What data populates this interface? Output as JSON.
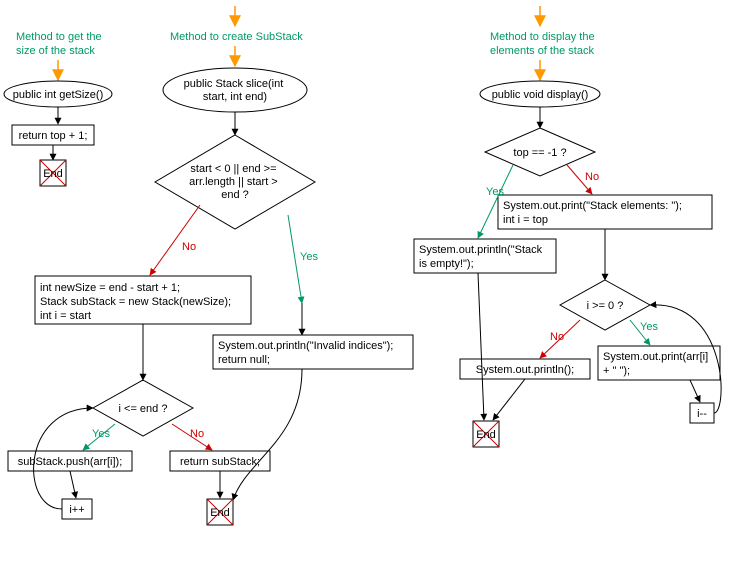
{
  "labels": {
    "yes": "Yes",
    "no": "No",
    "end": "End"
  },
  "colors": {
    "title": "#009966",
    "yes": "#009966",
    "no": "#cc0000",
    "arrowTitle": "#ff9900",
    "border": "#000000"
  },
  "left": {
    "title1": "Method to get the",
    "title2": "size of the stack",
    "sig": "public int getSize()",
    "ret": "return top + 1;"
  },
  "mid": {
    "title": "Method to create SubStack",
    "sig1": "public Stack slice(int",
    "sig2": "start, int end)",
    "cond1": "start < 0 || end >=",
    "cond2": "arr.length || start >",
    "cond3": "end ?",
    "init1": "int newSize = end - start + 1;",
    "init2": "Stack subStack = new Stack(newSize);",
    "init3": "int i = start",
    "invalid1": "System.out.println(\"Invalid indices\");",
    "invalid2": "return null;",
    "loopCond": "i <= end ?",
    "push": "subStack.push(arr[i]);",
    "inc": "i++",
    "retSub": "return subStack;"
  },
  "right": {
    "title1": "Method to display the",
    "title2": "elements of the stack",
    "sig": "public void display()",
    "cond": "top == -1 ?",
    "printHdr1": "System.out.print(\"Stack elements: \");",
    "printHdr2": "int i = top",
    "empty1": "System.out.println(\"Stack",
    "empty2": "is empty!\");",
    "loopCond": "i >= 0 ?",
    "println": "System.out.println();",
    "printEl1": "System.out.print(arr[i]",
    "printEl2": "+ \" \");",
    "dec": "i--"
  }
}
